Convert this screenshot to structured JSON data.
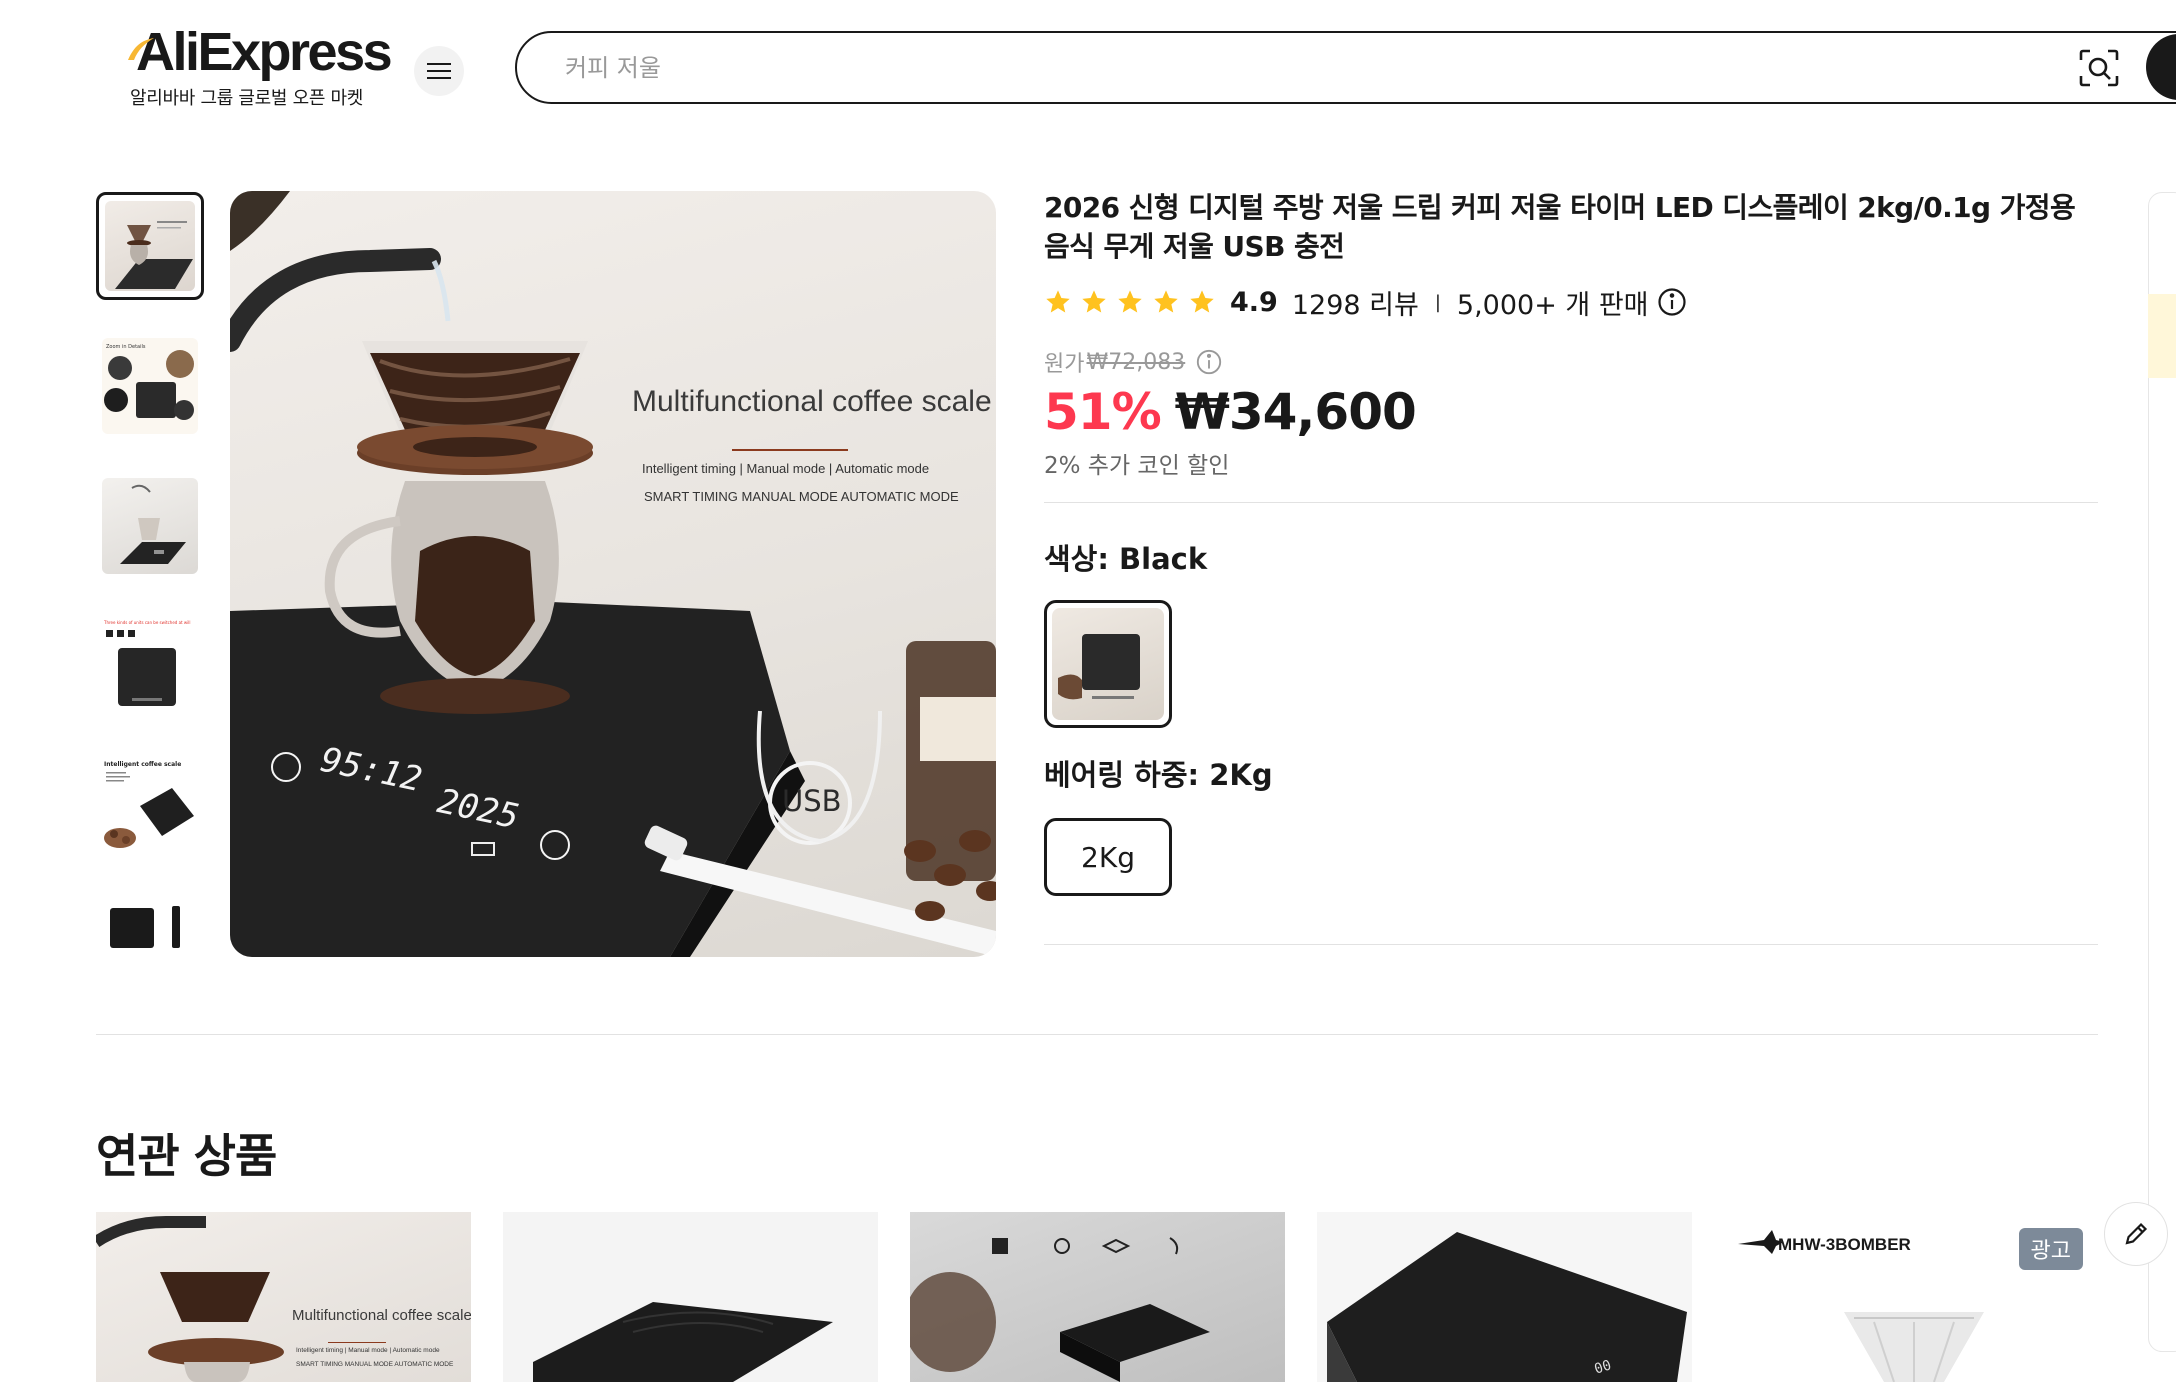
{
  "header": {
    "logo_text": "AliExpress",
    "logo_subtitle": "알리바바 그룹 글로벌 오픈 마켓",
    "search_placeholder": "커피 저울",
    "icons": [
      "menu-icon",
      "camera-search-icon"
    ]
  },
  "gallery": {
    "thumb_count": 6,
    "active_thumb": 0,
    "main_image": {
      "headline": "Multifunctional coffee scale",
      "line1": "Intelligent timing | Manual mode | Automatic mode",
      "line2": "SMART TIMING MANUAL MODE AUTOMATIC MODE",
      "display_left": "95:12",
      "display_right": "2025",
      "usb_label": "USB"
    },
    "thumb_captions": {
      "t2": "Zoom in Details",
      "t4": "Three kinds of units can be switched at will",
      "t5": "Intelligent coffee scale"
    }
  },
  "product": {
    "title": "2026 신형 디지털 주방 저울 드립 커피 저울 타이머 LED 디스플레이 2kg/0.1g 가정용 음식 무게 저울 USB 충전",
    "rating_score": "4.9",
    "stars": 5,
    "reviews": "1298 리뷰",
    "sold": "5,000+ 개 판매",
    "original_price_label": "원가",
    "original_price": "₩72,083",
    "discount": "51%",
    "price": "₩34,600",
    "coin_discount": "2% 추가 코인 할인",
    "color_label": "색상: Black",
    "bearing_label": "베어링 하중: 2Kg",
    "bearing_option": "2Kg"
  },
  "related": {
    "title": "연관 상품",
    "card1_headline": "Multifunctional coffee scale",
    "card1_line1": "Intelligent timing | Manual mode | Automatic mode",
    "card1_line2": "SMART TIMING MANUAL MODE AUTOMATIC MODE",
    "card5_brand": "MHW-3BOMBER",
    "ad_badge": "광고"
  },
  "colors": {
    "accent_red": "#fd384f",
    "star_yellow": "#ffc21f",
    "text": "#191919",
    "muted": "#999999"
  }
}
